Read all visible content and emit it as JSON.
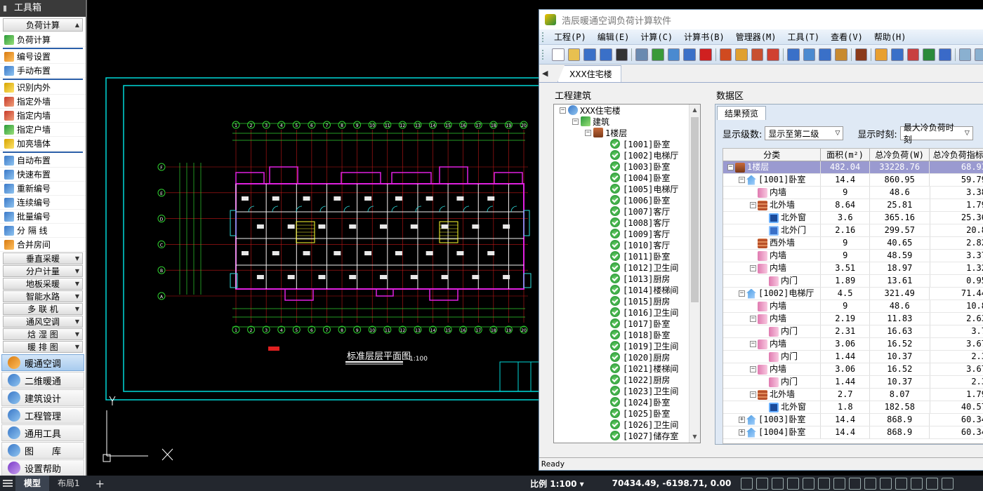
{
  "toolbox": {
    "title": "工具箱",
    "section_load": "负荷计算",
    "items_group1": [
      {
        "label": "负荷计算",
        "icon": "load-calc-icon",
        "color": "ig"
      }
    ],
    "items_group2": [
      {
        "label": "编号设置",
        "icon": "gear-icon",
        "color": "io"
      },
      {
        "label": "手动布置",
        "icon": "place-icon",
        "color": "ib"
      }
    ],
    "items_group3": [
      {
        "label": "识别内外",
        "icon": "identify-icon",
        "color": "iy"
      },
      {
        "label": "指定外墙",
        "icon": "outer-wall-icon",
        "color": "ir"
      },
      {
        "label": "指定内墙",
        "icon": "inner-wall-icon",
        "color": "ir"
      },
      {
        "label": "指定户墙",
        "icon": "unit-wall-icon",
        "color": "ig"
      },
      {
        "label": "加亮墙体",
        "icon": "highlight-wall-icon",
        "color": "iy"
      }
    ],
    "items_group4": [
      {
        "label": "自动布置",
        "icon": "auto-place-icon",
        "color": "ib"
      },
      {
        "label": "快速布置",
        "icon": "quick-place-icon",
        "color": "ib"
      },
      {
        "label": "重新编号",
        "icon": "renumber-icon",
        "color": "ib"
      },
      {
        "label": "连续编号",
        "icon": "seq-number-icon",
        "color": "ib"
      },
      {
        "label": "批量编号",
        "icon": "batch-number-icon",
        "color": "ib"
      },
      {
        "label": "分 隔 线",
        "icon": "divider-line-icon",
        "color": "ib"
      },
      {
        "label": "合并房间",
        "icon": "merge-room-icon",
        "color": "io"
      }
    ],
    "sections": [
      "垂直采暖",
      "分户计量",
      "地板采暖",
      "智能水路",
      "多 联 机",
      "通风空调",
      "焓 湿 图",
      "暖 排 图"
    ],
    "modules": [
      {
        "label": "暖通空调",
        "icon": "hvac-icon",
        "active": true
      },
      {
        "label": "二维暖通",
        "icon": "hvac-2d-icon",
        "active": false
      },
      {
        "label": "建筑设计",
        "icon": "architecture-icon",
        "active": false
      },
      {
        "label": "工程管理",
        "icon": "project-manage-icon",
        "active": false
      },
      {
        "label": "通用工具",
        "icon": "general-tools-icon",
        "active": false
      },
      {
        "label": "图　　库",
        "icon": "library-icon",
        "active": false
      },
      {
        "label": "设置帮助",
        "icon": "settings-help-icon",
        "active": false
      }
    ]
  },
  "drawing": {
    "title": "标准层层平面图",
    "scale": "1:100",
    "grid_top": [
      "1",
      "2",
      "3",
      "4",
      "5",
      "6",
      "7",
      "8",
      "9",
      "10",
      "11",
      "12",
      "13",
      "14",
      "15",
      "16",
      "17",
      "18",
      "19",
      "20"
    ],
    "grid_left": [
      "F",
      "E",
      "D",
      "C",
      "B",
      "A"
    ]
  },
  "calc": {
    "title": "浩辰暖通空调负荷计算软件",
    "menus": [
      "工程(P)",
      "编辑(E)",
      "计算(C)",
      "计算书(B)",
      "管理器(M)",
      "工具(T)",
      "查看(V)",
      "帮助(H)"
    ],
    "tab": "XXX住宅楼",
    "left_label": "工程建筑",
    "right_label": "数据区",
    "result_tab": "结果预览",
    "filter_level_label": "显示级数:",
    "filter_level_value": "显示至第二级",
    "filter_time_label": "显示时刻:",
    "filter_time_value": "最大冷负荷时刻",
    "status": "Ready",
    "tree": {
      "root": "XXX住宅楼",
      "building": "建筑",
      "floor": "1楼层",
      "rooms": [
        "[1001]卧室",
        "[1002]电梯厅",
        "[1003]卧室",
        "[1004]卧室",
        "[1005]电梯厅",
        "[1006]卧室",
        "[1007]客厅",
        "[1008]客厅",
        "[1009]客厅",
        "[1010]客厅",
        "[1011]卧室",
        "[1012]卫生间",
        "[1013]厨房",
        "[1014]楼梯间",
        "[1015]厨房",
        "[1016]卫生间",
        "[1017]卧室",
        "[1018]卧室",
        "[1019]卫生间",
        "[1020]厨房",
        "[1021]楼梯间",
        "[1022]厨房",
        "[1023]卫生间",
        "[1024]卧室",
        "[1025]卧室",
        "[1026]卫生间",
        "[1027]储存室"
      ]
    },
    "columns": [
      "分类",
      "面积(m²)",
      "总冷负荷(W)",
      "总冷负荷指标"
    ],
    "rows": [
      {
        "level": 0,
        "tog": "−",
        "icon": "gi-floor",
        "name": "1楼层",
        "area": "482.04",
        "load": "33228.76",
        "index": "68.93",
        "sel": true
      },
      {
        "level": 1,
        "tog": "−",
        "icon": "gi-room",
        "name": "[1001]卧室",
        "area": "14.4",
        "load": "860.95",
        "index": "59.79"
      },
      {
        "level": 2,
        "tog": "",
        "icon": "gi-inwall",
        "name": "内墙",
        "area": "9",
        "load": "48.6",
        "index": "3.38"
      },
      {
        "level": 2,
        "tog": "−",
        "icon": "gi-outwall",
        "name": "北外墙",
        "area": "8.64",
        "load": "25.81",
        "index": "1.79"
      },
      {
        "level": 3,
        "tog": "",
        "icon": "gi-window",
        "name": "北外窗",
        "area": "3.6",
        "load": "365.16",
        "index": "25.36"
      },
      {
        "level": 3,
        "tog": "",
        "icon": "gi-door",
        "name": "北外门",
        "area": "2.16",
        "load": "299.57",
        "index": "20.8"
      },
      {
        "level": 2,
        "tog": "",
        "icon": "gi-outwall",
        "name": "西外墙",
        "area": "9",
        "load": "40.65",
        "index": "2.82"
      },
      {
        "level": 2,
        "tog": "",
        "icon": "gi-inwall",
        "name": "内墙",
        "area": "9",
        "load": "48.59",
        "index": "3.37"
      },
      {
        "level": 2,
        "tog": "−",
        "icon": "gi-inwall",
        "name": "内墙",
        "area": "3.51",
        "load": "18.97",
        "index": "1.32"
      },
      {
        "level": 3,
        "tog": "",
        "icon": "gi-inwall",
        "name": "内门",
        "area": "1.89",
        "load": "13.61",
        "index": "0.95"
      },
      {
        "level": 1,
        "tog": "−",
        "icon": "gi-room",
        "name": "[1002]电梯厅",
        "area": "4.5",
        "load": "321.49",
        "index": "71.44"
      },
      {
        "level": 2,
        "tog": "",
        "icon": "gi-inwall",
        "name": "内墙",
        "area": "9",
        "load": "48.6",
        "index": "10.8"
      },
      {
        "level": 2,
        "tog": "−",
        "icon": "gi-inwall",
        "name": "内墙",
        "area": "2.19",
        "load": "11.83",
        "index": "2.63"
      },
      {
        "level": 3,
        "tog": "",
        "icon": "gi-inwall",
        "name": "内门",
        "area": "2.31",
        "load": "16.63",
        "index": "3.7"
      },
      {
        "level": 2,
        "tog": "−",
        "icon": "gi-inwall",
        "name": "内墙",
        "area": "3.06",
        "load": "16.52",
        "index": "3.67"
      },
      {
        "level": 3,
        "tog": "",
        "icon": "gi-inwall",
        "name": "内门",
        "area": "1.44",
        "load": "10.37",
        "index": "2.3"
      },
      {
        "level": 2,
        "tog": "−",
        "icon": "gi-inwall",
        "name": "内墙",
        "area": "3.06",
        "load": "16.52",
        "index": "3.67"
      },
      {
        "level": 3,
        "tog": "",
        "icon": "gi-inwall",
        "name": "内门",
        "area": "1.44",
        "load": "10.37",
        "index": "2.3"
      },
      {
        "level": 2,
        "tog": "−",
        "icon": "gi-outwall",
        "name": "北外墙",
        "area": "2.7",
        "load": "8.07",
        "index": "1.79"
      },
      {
        "level": 3,
        "tog": "",
        "icon": "gi-window",
        "name": "北外窗",
        "area": "1.8",
        "load": "182.58",
        "index": "40.57"
      },
      {
        "level": 1,
        "tog": "+",
        "icon": "gi-room",
        "name": "[1003]卧室",
        "area": "14.4",
        "load": "868.9",
        "index": "60.34"
      },
      {
        "level": 1,
        "tog": "+",
        "icon": "gi-room",
        "name": "[1004]卧室",
        "area": "14.4",
        "load": "868.9",
        "index": "60.34"
      }
    ]
  },
  "cad_status": {
    "tab_model": "模型",
    "tab_layout": "布局1",
    "plus": "+",
    "scale": "比例 1:100 ▾",
    "coords": "70434.49, -6198.71, 0.00"
  }
}
